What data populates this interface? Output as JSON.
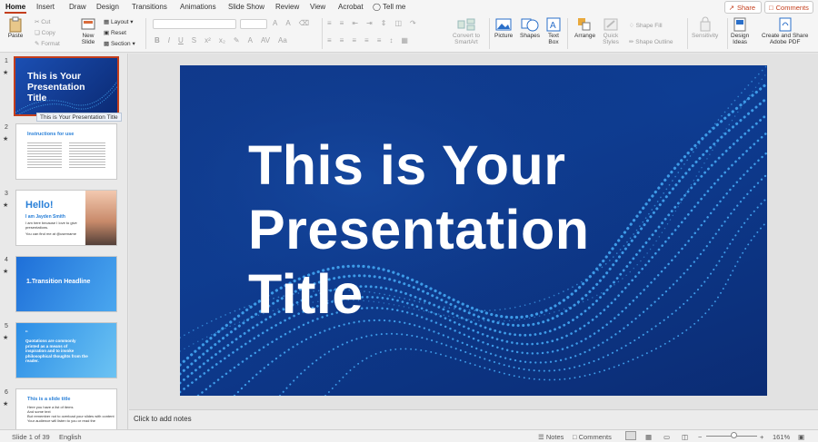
{
  "tabs": [
    "Home",
    "Insert",
    "Draw",
    "Design",
    "Transitions",
    "Animations",
    "Slide Show",
    "Review",
    "View",
    "Acrobat"
  ],
  "tell_me": "Tell me",
  "share_label": "Share",
  "comments_label": "Comments",
  "ribbon": {
    "paste": "Paste",
    "cut": "Cut",
    "copy": "Copy",
    "format": "Format",
    "new_slide": "New\nSlide",
    "layout": "Layout",
    "reset": "Reset",
    "section": "Section",
    "convert": "Convert to\nSmartArt",
    "picture": "Picture",
    "shapes": "Shapes",
    "text_box": "Text\nBox",
    "arrange": "Arrange",
    "quick_styles": "Quick\nStyles",
    "shape_fill": "Shape Fill",
    "shape_outline": "Shape Outline",
    "sensitivity": "Sensitivity",
    "design_ideas": "Design\nIdeas",
    "create_share": "Create and Share\nAdobe PDF"
  },
  "thumbnails": [
    {
      "num": "1",
      "title": "This is Your Presentation Title"
    },
    {
      "num": "2",
      "title": "Instructions for use"
    },
    {
      "num": "3",
      "title": "Hello!",
      "subtitle": "I am Jayden Smith",
      "body": "I am here because I love to give presentations.",
      "body2": "You can find me at @username"
    },
    {
      "num": "4",
      "title": "1.Transition Headline"
    },
    {
      "num": "5",
      "title": "Quotations are commonly printed as a means of inspiration and to invoke philosophical thoughts from the reader."
    },
    {
      "num": "6",
      "title": "This is a slide title",
      "bullets": [
        "Here you have a list of items",
        "And some text",
        "But remember not to overload your slides with content"
      ],
      "footer": "Your audience will listen to you or read the"
    }
  ],
  "tooltip": "This is Your Presentation Title",
  "slide": {
    "title_lines": [
      "This is Your",
      "Presentation",
      "Title"
    ]
  },
  "notes_placeholder": "Click to add notes",
  "status": {
    "slide_info": "Slide 1 of 39",
    "language": "English",
    "notes": "Notes",
    "comments": "Comments",
    "zoom": "161%"
  },
  "colors": {
    "accent": "#c43e1c",
    "slide_bg": "#0e3d93",
    "wave": "#3d9be8"
  }
}
